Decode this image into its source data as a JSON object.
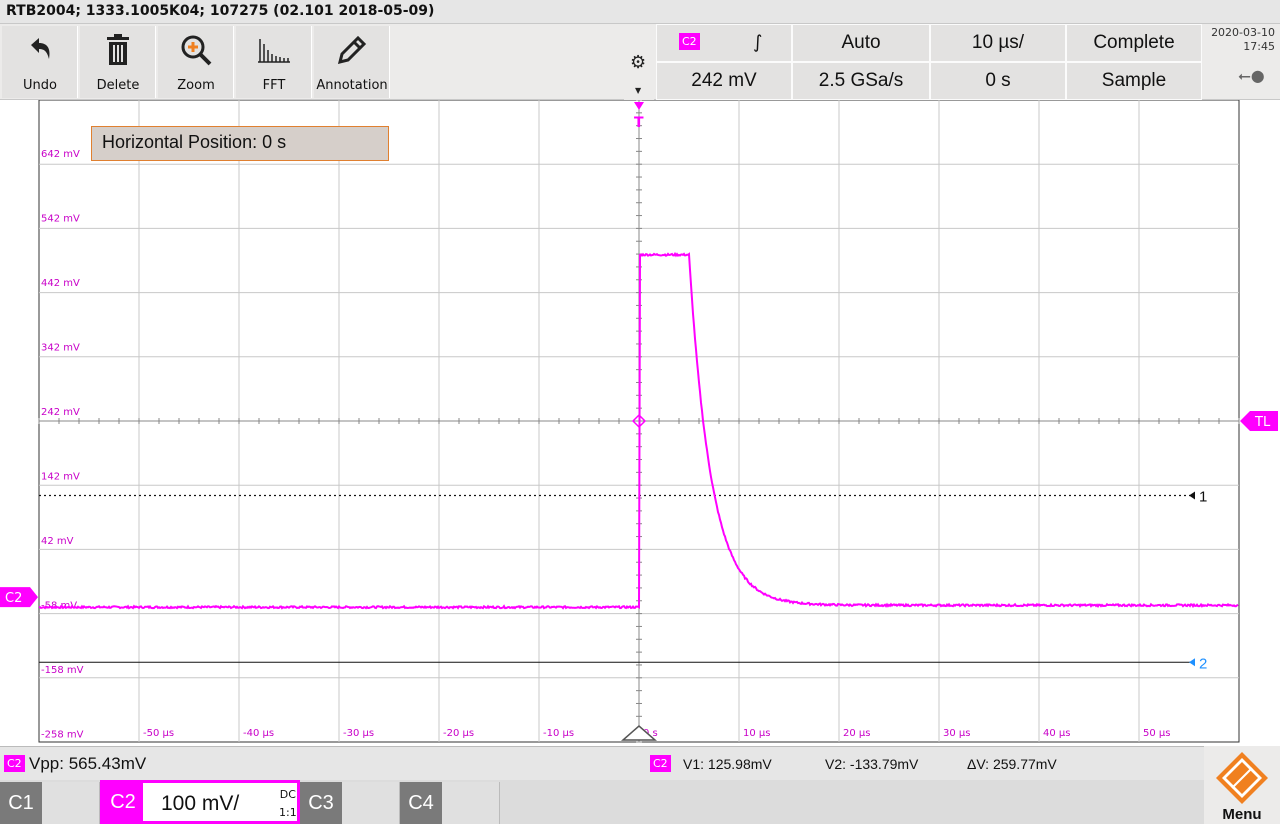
{
  "title": "RTB2004; 1333.1005K04; 107275 (02.101 2018-05-09)",
  "toolbar": {
    "undo_label": "Undo",
    "delete_label": "Delete",
    "zoom_label": "Zoom",
    "fft_label": "FFT",
    "annotation_label": "Annotation"
  },
  "trigger": {
    "source": "C2",
    "slope_symbol": "∫",
    "mode": "Auto",
    "level": "242 mV",
    "timebase": "10 µs/",
    "sample_rate": "2.5 GSa/s",
    "acq_state": "Complete",
    "h_position": "0 s",
    "acq_mode": "Sample"
  },
  "datetime": {
    "date": "2020-03-10",
    "time": "17:45"
  },
  "hpos_message": "Horizontal Position: 0 s",
  "graticule": {
    "y_labels": [
      "642 mV",
      "542 mV",
      "442 mV",
      "342 mV",
      "242 mV",
      "142 mV",
      "42 mV",
      "-58 mV",
      "-158 mV",
      "-258 mV"
    ],
    "x_labels": [
      "-50 µs",
      "-40 µs",
      "-30 µs",
      "-20 µs",
      "-10 µs",
      "0 s",
      "10 µs",
      "20 µs",
      "30 µs",
      "40 µs",
      "50 µs"
    ],
    "trigger_marker": "T",
    "trigger_level_marker": "TL",
    "ch_marker": "C2",
    "cursor1_label": "1",
    "cursor2_label": "2"
  },
  "waveform": {
    "color": "#ff00ff",
    "baseline_mv": -48,
    "peak_mv": 501,
    "settled_mv": -45,
    "edge_us": 0.1,
    "fall_start_us": 5,
    "tau_us": 2.2,
    "x_range_us": [
      -60,
      60
    ],
    "y_range_mv": [
      -258,
      742
    ]
  },
  "cursors": {
    "v1_mv": 125.98,
    "v2_mv": -133.79
  },
  "measurement": {
    "channel": "C2",
    "vpp": "Vpp: 565.43mV",
    "v1": "V1: 125.98mV",
    "v2": "V2: -133.79mV",
    "dv": "ΔV: 259.77mV"
  },
  "channels": {
    "c1": "C1",
    "c2": "C2",
    "c2_scale": "100 mV/",
    "c2_coupling": "DC",
    "c2_probe": "1:1",
    "c3": "C3",
    "c4": "C4"
  },
  "menu_label": "Menu",
  "colors": {
    "accent": "#ff00ff",
    "cursor2": "#1e90ff",
    "logo_orange": "#f08020"
  }
}
